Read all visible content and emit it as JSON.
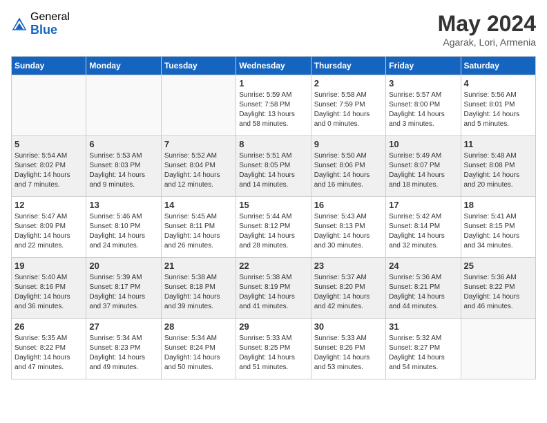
{
  "logo": {
    "general": "General",
    "blue": "Blue"
  },
  "title": {
    "month_year": "May 2024",
    "location": "Agarak, Lori, Armenia"
  },
  "days_of_week": [
    "Sunday",
    "Monday",
    "Tuesday",
    "Wednesday",
    "Thursday",
    "Friday",
    "Saturday"
  ],
  "weeks": [
    [
      {
        "day": "",
        "sunrise": "",
        "sunset": "",
        "daylight": ""
      },
      {
        "day": "",
        "sunrise": "",
        "sunset": "",
        "daylight": ""
      },
      {
        "day": "",
        "sunrise": "",
        "sunset": "",
        "daylight": ""
      },
      {
        "day": "1",
        "sunrise": "Sunrise: 5:59 AM",
        "sunset": "Sunset: 7:58 PM",
        "daylight": "Daylight: 13 hours and 58 minutes."
      },
      {
        "day": "2",
        "sunrise": "Sunrise: 5:58 AM",
        "sunset": "Sunset: 7:59 PM",
        "daylight": "Daylight: 14 hours and 0 minutes."
      },
      {
        "day": "3",
        "sunrise": "Sunrise: 5:57 AM",
        "sunset": "Sunset: 8:00 PM",
        "daylight": "Daylight: 14 hours and 3 minutes."
      },
      {
        "day": "4",
        "sunrise": "Sunrise: 5:56 AM",
        "sunset": "Sunset: 8:01 PM",
        "daylight": "Daylight: 14 hours and 5 minutes."
      }
    ],
    [
      {
        "day": "5",
        "sunrise": "Sunrise: 5:54 AM",
        "sunset": "Sunset: 8:02 PM",
        "daylight": "Daylight: 14 hours and 7 minutes."
      },
      {
        "day": "6",
        "sunrise": "Sunrise: 5:53 AM",
        "sunset": "Sunset: 8:03 PM",
        "daylight": "Daylight: 14 hours and 9 minutes."
      },
      {
        "day": "7",
        "sunrise": "Sunrise: 5:52 AM",
        "sunset": "Sunset: 8:04 PM",
        "daylight": "Daylight: 14 hours and 12 minutes."
      },
      {
        "day": "8",
        "sunrise": "Sunrise: 5:51 AM",
        "sunset": "Sunset: 8:05 PM",
        "daylight": "Daylight: 14 hours and 14 minutes."
      },
      {
        "day": "9",
        "sunrise": "Sunrise: 5:50 AM",
        "sunset": "Sunset: 8:06 PM",
        "daylight": "Daylight: 14 hours and 16 minutes."
      },
      {
        "day": "10",
        "sunrise": "Sunrise: 5:49 AM",
        "sunset": "Sunset: 8:07 PM",
        "daylight": "Daylight: 14 hours and 18 minutes."
      },
      {
        "day": "11",
        "sunrise": "Sunrise: 5:48 AM",
        "sunset": "Sunset: 8:08 PM",
        "daylight": "Daylight: 14 hours and 20 minutes."
      }
    ],
    [
      {
        "day": "12",
        "sunrise": "Sunrise: 5:47 AM",
        "sunset": "Sunset: 8:09 PM",
        "daylight": "Daylight: 14 hours and 22 minutes."
      },
      {
        "day": "13",
        "sunrise": "Sunrise: 5:46 AM",
        "sunset": "Sunset: 8:10 PM",
        "daylight": "Daylight: 14 hours and 24 minutes."
      },
      {
        "day": "14",
        "sunrise": "Sunrise: 5:45 AM",
        "sunset": "Sunset: 8:11 PM",
        "daylight": "Daylight: 14 hours and 26 minutes."
      },
      {
        "day": "15",
        "sunrise": "Sunrise: 5:44 AM",
        "sunset": "Sunset: 8:12 PM",
        "daylight": "Daylight: 14 hours and 28 minutes."
      },
      {
        "day": "16",
        "sunrise": "Sunrise: 5:43 AM",
        "sunset": "Sunset: 8:13 PM",
        "daylight": "Daylight: 14 hours and 30 minutes."
      },
      {
        "day": "17",
        "sunrise": "Sunrise: 5:42 AM",
        "sunset": "Sunset: 8:14 PM",
        "daylight": "Daylight: 14 hours and 32 minutes."
      },
      {
        "day": "18",
        "sunrise": "Sunrise: 5:41 AM",
        "sunset": "Sunset: 8:15 PM",
        "daylight": "Daylight: 14 hours and 34 minutes."
      }
    ],
    [
      {
        "day": "19",
        "sunrise": "Sunrise: 5:40 AM",
        "sunset": "Sunset: 8:16 PM",
        "daylight": "Daylight: 14 hours and 36 minutes."
      },
      {
        "day": "20",
        "sunrise": "Sunrise: 5:39 AM",
        "sunset": "Sunset: 8:17 PM",
        "daylight": "Daylight: 14 hours and 37 minutes."
      },
      {
        "day": "21",
        "sunrise": "Sunrise: 5:38 AM",
        "sunset": "Sunset: 8:18 PM",
        "daylight": "Daylight: 14 hours and 39 minutes."
      },
      {
        "day": "22",
        "sunrise": "Sunrise: 5:38 AM",
        "sunset": "Sunset: 8:19 PM",
        "daylight": "Daylight: 14 hours and 41 minutes."
      },
      {
        "day": "23",
        "sunrise": "Sunrise: 5:37 AM",
        "sunset": "Sunset: 8:20 PM",
        "daylight": "Daylight: 14 hours and 42 minutes."
      },
      {
        "day": "24",
        "sunrise": "Sunrise: 5:36 AM",
        "sunset": "Sunset: 8:21 PM",
        "daylight": "Daylight: 14 hours and 44 minutes."
      },
      {
        "day": "25",
        "sunrise": "Sunrise: 5:36 AM",
        "sunset": "Sunset: 8:22 PM",
        "daylight": "Daylight: 14 hours and 46 minutes."
      }
    ],
    [
      {
        "day": "26",
        "sunrise": "Sunrise: 5:35 AM",
        "sunset": "Sunset: 8:22 PM",
        "daylight": "Daylight: 14 hours and 47 minutes."
      },
      {
        "day": "27",
        "sunrise": "Sunrise: 5:34 AM",
        "sunset": "Sunset: 8:23 PM",
        "daylight": "Daylight: 14 hours and 49 minutes."
      },
      {
        "day": "28",
        "sunrise": "Sunrise: 5:34 AM",
        "sunset": "Sunset: 8:24 PM",
        "daylight": "Daylight: 14 hours and 50 minutes."
      },
      {
        "day": "29",
        "sunrise": "Sunrise: 5:33 AM",
        "sunset": "Sunset: 8:25 PM",
        "daylight": "Daylight: 14 hours and 51 minutes."
      },
      {
        "day": "30",
        "sunrise": "Sunrise: 5:33 AM",
        "sunset": "Sunset: 8:26 PM",
        "daylight": "Daylight: 14 hours and 53 minutes."
      },
      {
        "day": "31",
        "sunrise": "Sunrise: 5:32 AM",
        "sunset": "Sunset: 8:27 PM",
        "daylight": "Daylight: 14 hours and 54 minutes."
      },
      {
        "day": "",
        "sunrise": "",
        "sunset": "",
        "daylight": ""
      }
    ]
  ]
}
